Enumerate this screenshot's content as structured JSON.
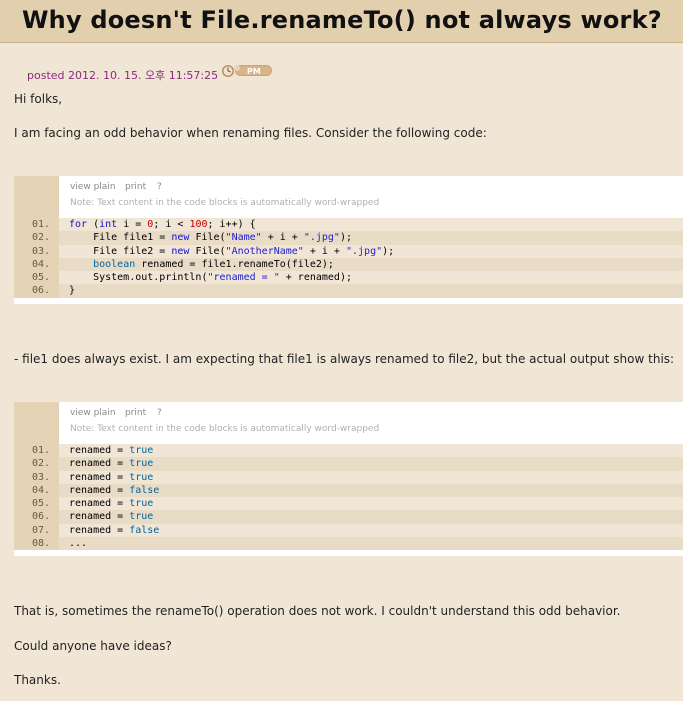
{
  "post": {
    "title": "Why doesn't File.renameTo() not always work?",
    "posted": "posted 2012. 10. 15. 오후 11:57:25",
    "badge": "PM",
    "greeting": "Hi folks,",
    "intro": "I am facing an odd behavior when renaming files. Consider the following code:",
    "middle": "- file1 does always exist. I am expecting that file1 is always renamed to file2, but the actual output show this:",
    "outro": "That is, sometimes the renameTo() operation does not work. I couldn't understand this odd behavior.",
    "question": "Could anyone have ideas?",
    "thanks": "Thanks."
  },
  "code_toolbar": {
    "view_plain": "view plain",
    "print": "print",
    "help": "?",
    "note": "Note: Text content in the code blocks is automatically word-wrapped"
  },
  "code_block_1": {
    "lines": [
      {
        "num": "01.",
        "segments": [
          {
            "t": "for",
            "c": "kw"
          },
          {
            "t": " ("
          },
          {
            "t": "int",
            "c": "kw"
          },
          {
            "t": " i = "
          },
          {
            "t": "0",
            "c": "numlit"
          },
          {
            "t": "; i < "
          },
          {
            "t": "100",
            "c": "numlit"
          },
          {
            "t": "; i++) {"
          }
        ]
      },
      {
        "num": "02.",
        "segments": [
          {
            "t": "    File file1 = "
          },
          {
            "t": "new",
            "c": "kw"
          },
          {
            "t": " File("
          },
          {
            "t": "\"Name\"",
            "c": "str"
          },
          {
            "t": " + i + "
          },
          {
            "t": "\".jpg\"",
            "c": "str"
          },
          {
            "t": ");"
          }
        ]
      },
      {
        "num": "03.",
        "segments": [
          {
            "t": "    File file2 = "
          },
          {
            "t": "new",
            "c": "kw"
          },
          {
            "t": " File("
          },
          {
            "t": "\"AnotherName\"",
            "c": "str"
          },
          {
            "t": " + i + "
          },
          {
            "t": "\".jpg\"",
            "c": "str"
          },
          {
            "t": ");"
          }
        ]
      },
      {
        "num": "04.",
        "segments": [
          {
            "t": "    "
          },
          {
            "t": "boolean",
            "c": "kwt"
          },
          {
            "t": " renamed = file1.renameTo(file2);"
          }
        ]
      },
      {
        "num": "05.",
        "segments": [
          {
            "t": "    System.out.println("
          },
          {
            "t": "\"renamed = \"",
            "c": "str"
          },
          {
            "t": " + renamed);"
          }
        ]
      },
      {
        "num": "06.",
        "segments": [
          {
            "t": "}"
          }
        ]
      }
    ]
  },
  "code_block_2": {
    "lines": [
      {
        "num": "01.",
        "segments": [
          {
            "t": "renamed = "
          },
          {
            "t": "true",
            "c": "kwt"
          }
        ]
      },
      {
        "num": "02.",
        "segments": [
          {
            "t": "renamed = "
          },
          {
            "t": "true",
            "c": "kwt"
          }
        ]
      },
      {
        "num": "03.",
        "segments": [
          {
            "t": "renamed = "
          },
          {
            "t": "true",
            "c": "kwt"
          }
        ]
      },
      {
        "num": "04.",
        "segments": [
          {
            "t": "renamed = "
          },
          {
            "t": "false",
            "c": "kwt"
          }
        ]
      },
      {
        "num": "05.",
        "segments": [
          {
            "t": "renamed = "
          },
          {
            "t": "true",
            "c": "kwt"
          }
        ]
      },
      {
        "num": "06.",
        "segments": [
          {
            "t": "renamed = "
          },
          {
            "t": "true",
            "c": "kwt"
          }
        ]
      },
      {
        "num": "07.",
        "segments": [
          {
            "t": "renamed = "
          },
          {
            "t": "false",
            "c": "kwt"
          }
        ]
      },
      {
        "num": "08.",
        "segments": [
          {
            "t": "..."
          }
        ]
      }
    ]
  },
  "colors": {
    "page_bg": "#f1e6d6",
    "title_bar": "#e2cfae",
    "posted_text": "#8b2a7a",
    "keyword": "#1010c8",
    "string": "#2020d0",
    "number": "#c00000"
  },
  "icons": {
    "pm_badge": "pm-time-badge-icon"
  }
}
